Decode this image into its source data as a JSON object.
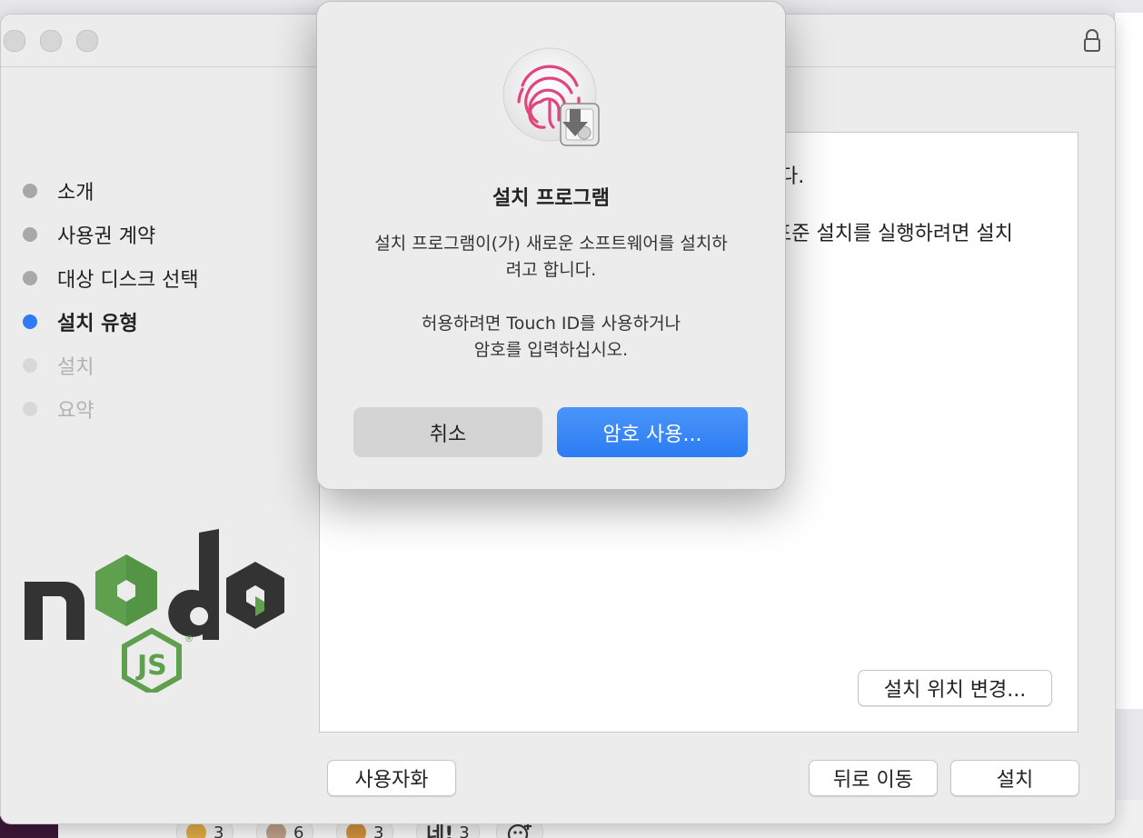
{
  "installer": {
    "steps": [
      {
        "label": "소개",
        "state": "done"
      },
      {
        "label": "사용권 계약",
        "state": "done"
      },
      {
        "label": "대상 디스크 선택",
        "state": "done"
      },
      {
        "label": "설치 유형",
        "state": "current"
      },
      {
        "label": "설치",
        "state": "pending"
      },
      {
        "label": "요약",
        "state": "pending"
      }
    ],
    "content": {
      "line1_tail": "다.",
      "line2_tail": "표준 설치를 실행하려면 설치"
    },
    "buttons": {
      "customize": "사용자화",
      "change_location": "설치 위치 변경...",
      "go_back": "뒤로 이동",
      "install": "설치"
    },
    "logo": {
      "label": "node-js-logo",
      "brand_dark": "#333333",
      "brand_green": "#5fa04e"
    }
  },
  "dialog": {
    "title": "설치 프로그램",
    "message_line1": "설치 프로그램이(가) 새로운 소프트웨어를 설치하",
    "message_line2": "려고 합니다.",
    "prompt_line1": "허용하려면 Touch ID를 사용하거나",
    "prompt_line2": "암호를 입력하십시오.",
    "cancel_label": "취소",
    "use_password_label": "암호 사용...",
    "icon": "touch-id-fingerprint-icon",
    "accent": "#2f7bf5"
  },
  "background": {
    "reactions": [
      {
        "count": "3"
      },
      {
        "count": "6"
      },
      {
        "count": "3"
      },
      {
        "label": "네!",
        "count": "3"
      }
    ]
  }
}
